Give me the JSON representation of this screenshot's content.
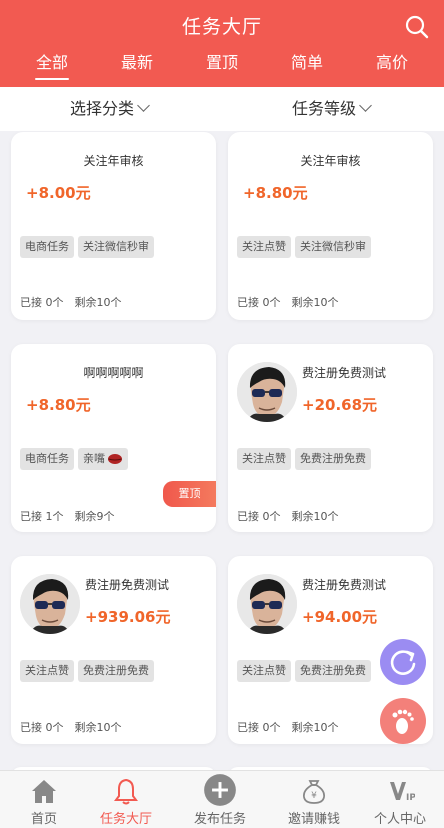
{
  "header": {
    "title": "任务大厅"
  },
  "tabs": [
    {
      "label": "全部"
    },
    {
      "label": "最新"
    },
    {
      "label": "置顶"
    },
    {
      "label": "简单"
    },
    {
      "label": "高价"
    }
  ],
  "filters": {
    "category": "选择分类",
    "level": "任务等级"
  },
  "cards": [
    {
      "name": "关注年审核",
      "price": "+8.00元",
      "tags": [
        "电商任务",
        "关注微信秒审"
      ],
      "accepted": "已接 0个",
      "remaining": "剩余10个"
    },
    {
      "name": "关注年审核",
      "price": "+8.80元",
      "tags": [
        "关注点赞",
        "关注微信秒审"
      ],
      "accepted": "已接 0个",
      "remaining": "剩余10个"
    },
    {
      "name": "啊啊啊啊啊",
      "price": "+8.80元",
      "tags": [
        "电商任务",
        "亲嘴"
      ],
      "accepted": "已接 1个",
      "remaining": "剩余9个",
      "badge": "置顶"
    },
    {
      "name": "费注册免费测试",
      "price": "+20.68元",
      "tags": [
        "关注点赞",
        "免费注册免费"
      ],
      "accepted": "已接 0个",
      "remaining": "剩余10个"
    },
    {
      "name": "费注册免费测试",
      "price": "+939.06元",
      "tags": [
        "关注点赞",
        "免费注册免费"
      ],
      "accepted": "已接 0个",
      "remaining": "剩余10个"
    },
    {
      "name": "费注册免费测试",
      "price": "+94.00元",
      "tags": [
        "关注点赞",
        "免费注册免费"
      ],
      "accepted": "已接 0个",
      "remaining": "剩余10个"
    }
  ],
  "bottom_nav": [
    {
      "label": "首页",
      "icon": "home-icon"
    },
    {
      "label": "任务大厅",
      "icon": "bell-icon"
    },
    {
      "label": "发布任务",
      "icon": "plus-icon"
    },
    {
      "label": "邀请赚钱",
      "icon": "money-bag-icon"
    },
    {
      "label": "个人中心",
      "icon": "vip-icon"
    }
  ],
  "colors": {
    "brand": "#f25a51",
    "price": "#f0652a",
    "refresh_fab": "#9b8cf2",
    "foot_fab": "#f3807a"
  }
}
